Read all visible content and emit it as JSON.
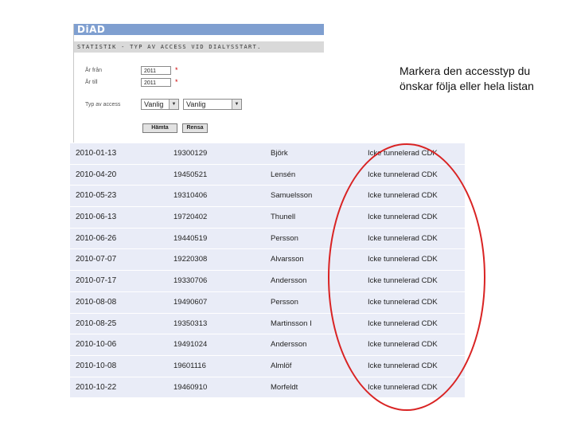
{
  "app": {
    "brand": "DiAD"
  },
  "form": {
    "heading": "STATISTIK - TYP AV ACCESS VID DIALYSSTART.",
    "from_label": "År från",
    "from_value": "2011",
    "to_label": "År till",
    "to_value": "2011",
    "required_mark": "*",
    "access_label": "Typ av access",
    "access_select_1": "Vanlig",
    "access_select_2": "Vanlig",
    "fetch_button": "Hämta",
    "reset_button": "Rensa"
  },
  "callout": {
    "line1": "Markera den accesstyp du",
    "line2": "önskar följa eller hela listan"
  },
  "rows": [
    {
      "date": "2010-01-13",
      "id": "19300129",
      "name": "Björk",
      "type": "Icke tunnelerad CDK"
    },
    {
      "date": "2010-04-20",
      "id": "19450521",
      "name": "Lensén",
      "type": "Icke tunnelerad CDK"
    },
    {
      "date": "2010-05-23",
      "id": "19310406",
      "name": "Samuelsson",
      "type": "Icke tunnelerad CDK"
    },
    {
      "date": "2010-06-13",
      "id": "19720402",
      "name": "Thunell",
      "type": "Icke tunnelerad CDK"
    },
    {
      "date": "2010-06-26",
      "id": "19440519",
      "name": "Persson",
      "type": "Icke tunnelerad CDK"
    },
    {
      "date": "2010-07-07",
      "id": "19220308",
      "name": "Alvarsson",
      "type": "Icke tunnelerad CDK"
    },
    {
      "date": "2010-07-17",
      "id": "19330706",
      "name": "Andersson",
      "type": "Icke tunnelerad CDK"
    },
    {
      "date": "2010-08-08",
      "id": "19490607",
      "name": "Persson",
      "type": "Icke tunnelerad CDK"
    },
    {
      "date": "2010-08-25",
      "id": "19350313",
      "name": "Martinsson I",
      "type": "Icke tunnelerad CDK"
    },
    {
      "date": "2010-10-06",
      "id": "19491024",
      "name": "Andersson",
      "type": "Icke tunnelerad CDK"
    },
    {
      "date": "2010-10-08",
      "id": "19601116",
      "name": "Almlöf",
      "type": "Icke tunnelerad CDK"
    },
    {
      "date": "2010-10-22",
      "id": "19460910",
      "name": "Morfeldt",
      "type": "Icke tunnelerad CDK"
    }
  ],
  "colors": {
    "brand_bar": "#7f9fd0",
    "row_background": "#e9ecf7",
    "highlight_ellipse": "#d92323"
  }
}
